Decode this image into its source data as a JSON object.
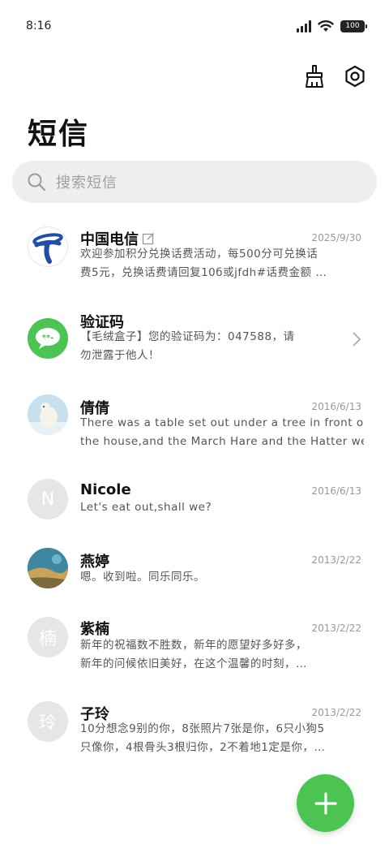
{
  "status": {
    "time": "8:16",
    "battery": "100"
  },
  "header": {
    "title": "短信",
    "clean_icon": "broom-icon",
    "settings_icon": "settings-hexagon-icon"
  },
  "search": {
    "placeholder": "搜索短信"
  },
  "colors": {
    "accent": "#4cc451",
    "telecom_blue": "#1f4ea8",
    "verify_green": "#4cc451"
  },
  "messages": [
    {
      "name": "中国电信",
      "date": "2025/9/30",
      "lines": [
        "欢迎参加积分兑换话费活动，每500分可兑换话",
        "费5元，兑换话费请回复10б或jfdh#话费金额 …"
      ],
      "avatar": "china-telecom-logo"
    },
    {
      "name": "验证码",
      "date": "",
      "lines": [
        "【毛绒盒子】您的验证码为：047588，请",
        "勿泄露于他人！"
      ],
      "avatar": "verification-code-icon"
    },
    {
      "name": "倩倩",
      "date": "2016/6/13",
      "lines": [
        "There was a table set out under a tree in front of",
        "the house,and the March Hare and the Hatter we…"
      ],
      "avatar": "polar-bear-photo"
    },
    {
      "name": "Nicole",
      "date": "2016/6/13",
      "lines": [
        "Let's eat out,shall we?"
      ],
      "avatar_letter": "N"
    },
    {
      "name": "燕婷",
      "date": "2013/2/22",
      "lines": [
        "嗯。收到啦。同乐同乐。"
      ],
      "avatar": "landscape-photo"
    },
    {
      "name": "紫楠",
      "date": "2013/2/22",
      "lines": [
        "新年的祝福数不胜数，新年的愿望好多好多，",
        "新年的问候依旧美好，在这个温馨的时刻，…"
      ],
      "avatar_letter": "楠"
    },
    {
      "name": "子玲",
      "date": "2013/2/22",
      "lines": [
        "10分想念9别的你，8张照片7张是你，6只小狗5",
        "只像你，4根骨头3根归你，2不着地1定是你，…"
      ],
      "avatar_letter": "玲"
    }
  ],
  "fab": {
    "icon": "plus-icon"
  }
}
